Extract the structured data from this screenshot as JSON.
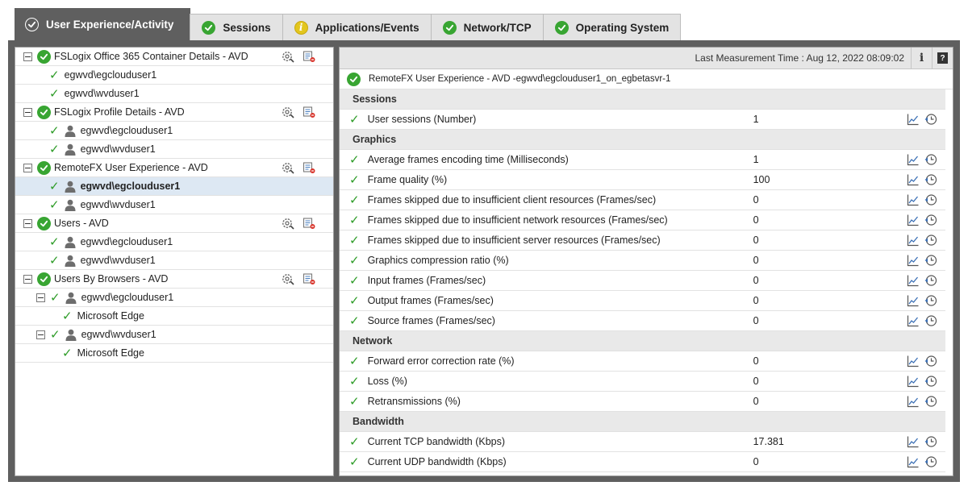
{
  "tabs": [
    {
      "label": "User Experience/Activity",
      "state": "ok",
      "active": true
    },
    {
      "label": "Sessions",
      "state": "ok",
      "active": false
    },
    {
      "label": "Applications/Events",
      "state": "info",
      "active": false
    },
    {
      "label": "Network/TCP",
      "state": "ok",
      "active": false
    },
    {
      "label": "Operating System",
      "state": "ok",
      "active": false
    }
  ],
  "tree": [
    {
      "type": "group",
      "label": "FSLogix Office 365 Container Details - AVD"
    },
    {
      "type": "item",
      "label": "egwvd\\egclouduser1",
      "user_icon": false
    },
    {
      "type": "item",
      "label": "egwvd\\wvduser1",
      "user_icon": false
    },
    {
      "type": "group",
      "label": "FSLogix Profile Details - AVD"
    },
    {
      "type": "item",
      "label": "egwvd\\egclouduser1",
      "user_icon": true
    },
    {
      "type": "item",
      "label": "egwvd\\wvduser1",
      "user_icon": true
    },
    {
      "type": "group",
      "label": "RemoteFX User Experience - AVD"
    },
    {
      "type": "item",
      "label": "egwvd\\egclouduser1",
      "user_icon": true,
      "selected": true
    },
    {
      "type": "item",
      "label": "egwvd\\wvduser1",
      "user_icon": true
    },
    {
      "type": "group",
      "label": "Users - AVD"
    },
    {
      "type": "item",
      "label": "egwvd\\egclouduser1",
      "user_icon": true
    },
    {
      "type": "item",
      "label": "egwvd\\wvduser1",
      "user_icon": true
    },
    {
      "type": "group",
      "label": "Users By Browsers - AVD"
    },
    {
      "type": "subgroup",
      "label": "egwvd\\egclouduser1"
    },
    {
      "type": "leaf",
      "label": "Microsoft Edge"
    },
    {
      "type": "subgroup",
      "label": "egwvd\\wvduser1"
    },
    {
      "type": "leaf",
      "label": "Microsoft Edge"
    }
  ],
  "header": {
    "measurement_time": "Last Measurement Time : Aug 12, 2022 08:09:02",
    "info_label": "i",
    "help_label": "?"
  },
  "test_title": "RemoteFX User Experience - AVD -egwvd\\egclouduser1_on_egbetasvr-1",
  "sections": [
    {
      "title": "Sessions",
      "rows": [
        {
          "name": "User sessions (Number)",
          "value": "1"
        }
      ]
    },
    {
      "title": "Graphics",
      "rows": [
        {
          "name": "Average frames encoding time (Milliseconds)",
          "value": "1"
        },
        {
          "name": "Frame quality (%)",
          "value": "100"
        },
        {
          "name": "Frames skipped due to insufficient client resources (Frames/sec)",
          "value": "0"
        },
        {
          "name": "Frames skipped due to insufficient network resources (Frames/sec)",
          "value": "0"
        },
        {
          "name": "Frames skipped due to insufficient server resources (Frames/sec)",
          "value": "0"
        },
        {
          "name": "Graphics compression ratio (%)",
          "value": "0"
        },
        {
          "name": "Input frames (Frames/sec)",
          "value": "0"
        },
        {
          "name": "Output frames (Frames/sec)",
          "value": "0"
        },
        {
          "name": "Source frames (Frames/sec)",
          "value": "0"
        }
      ]
    },
    {
      "title": "Network",
      "rows": [
        {
          "name": "Forward error correction rate (%)",
          "value": "0"
        },
        {
          "name": "Loss (%)",
          "value": "0"
        },
        {
          "name": "Retransmissions (%)",
          "value": "0"
        }
      ]
    },
    {
      "title": "Bandwidth",
      "rows": [
        {
          "name": "Current TCP bandwidth (Kbps)",
          "value": "17.381"
        },
        {
          "name": "Current UDP bandwidth (Kbps)",
          "value": "0"
        }
      ]
    }
  ],
  "colors": {
    "ok": "#38a532",
    "info": "#e3c61e",
    "frame": "#5f5f5f",
    "selected": "#dde8f3"
  },
  "icons": {
    "group_tools": [
      "config-icon",
      "report-icon"
    ],
    "metric_tools": [
      "graph-icon",
      "history-icon"
    ]
  }
}
